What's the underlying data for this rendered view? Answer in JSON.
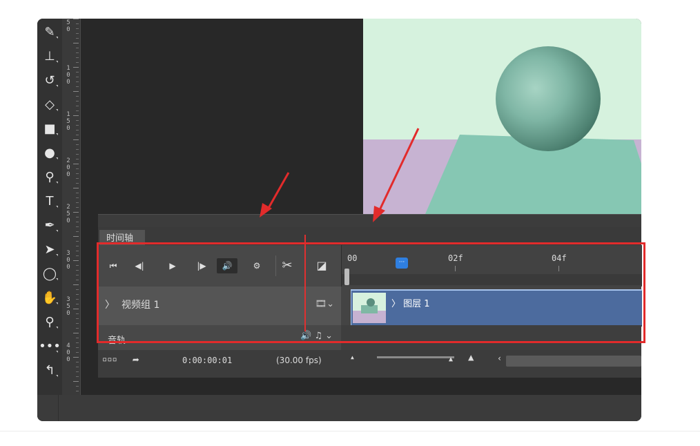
{
  "ruler_marks": [
    {
      "lines": [
        "5",
        "0"
      ]
    },
    {
      "lines": [
        "1",
        "0",
        "0"
      ]
    },
    {
      "lines": [
        "1",
        "5",
        "0"
      ]
    },
    {
      "lines": [
        "2",
        "0",
        "0"
      ]
    },
    {
      "lines": [
        "2",
        "5",
        "0"
      ]
    },
    {
      "lines": [
        "3",
        "0",
        "0"
      ]
    },
    {
      "lines": [
        "3",
        "5",
        "0"
      ]
    },
    {
      "lines": [
        "4",
        "0",
        "0"
      ]
    }
  ],
  "tools": [
    {
      "icon": "brush-icon",
      "glyph": "✎"
    },
    {
      "icon": "clone-stamp-icon",
      "glyph": "⊥"
    },
    {
      "icon": "history-brush-icon",
      "glyph": "↺"
    },
    {
      "icon": "eraser-icon",
      "glyph": "◇"
    },
    {
      "icon": "gradient-icon",
      "glyph": "■"
    },
    {
      "icon": "blur-icon",
      "glyph": "●"
    },
    {
      "icon": "dodge-icon",
      "glyph": "⚲"
    },
    {
      "icon": "type-icon",
      "glyph": "T"
    },
    {
      "icon": "pen-icon",
      "glyph": "✒"
    },
    {
      "icon": "path-select-icon",
      "glyph": "➤"
    },
    {
      "icon": "ellipse-icon",
      "glyph": "◯"
    },
    {
      "icon": "hand-icon",
      "glyph": "✋"
    },
    {
      "icon": "zoom-icon",
      "glyph": "⚲"
    },
    {
      "icon": "more-tools-icon",
      "glyph": "•••"
    },
    {
      "icon": "swap-colors-icon",
      "glyph": "↰"
    }
  ],
  "timeline": {
    "tab_label": "时间轴",
    "controls": [
      {
        "name": "go-to-first-frame-button",
        "glyph": "⏮"
      },
      {
        "name": "previous-frame-button",
        "glyph": "◀|"
      },
      {
        "name": "play-button",
        "glyph": "▶"
      },
      {
        "name": "next-frame-button",
        "glyph": "|▶"
      },
      {
        "name": "mute-audio-button",
        "glyph": "🔊"
      },
      {
        "name": "settings-button",
        "glyph": "⚙"
      },
      {
        "name": "split-at-playhead-button",
        "glyph": "✂"
      },
      {
        "name": "transition-button",
        "glyph": "◪"
      }
    ],
    "ruler_labels": [
      "00",
      "02f",
      "04f"
    ],
    "track_label": "视频组 1",
    "track_chevron": "〉",
    "film_icon": "🎞⌄",
    "clip_label": "〉 图层 1",
    "audio_label": "音轨",
    "audio_icons": "🔊 ♫ ⌄",
    "status": {
      "frames_icon": "▫▫▫",
      "render_icon": "➦",
      "timecode": "0:00:00:01",
      "fps": "(30.00 fps)",
      "zoom_out_glyph": "▲",
      "zoom_in_glyph": "▲",
      "scroll_left_glyph": "‹"
    }
  },
  "colors": {
    "highlight_box": "#e22b2b",
    "arrow": "#e22b2b",
    "clip": "#4c6b9e",
    "playhead": "#2f7fe0"
  }
}
